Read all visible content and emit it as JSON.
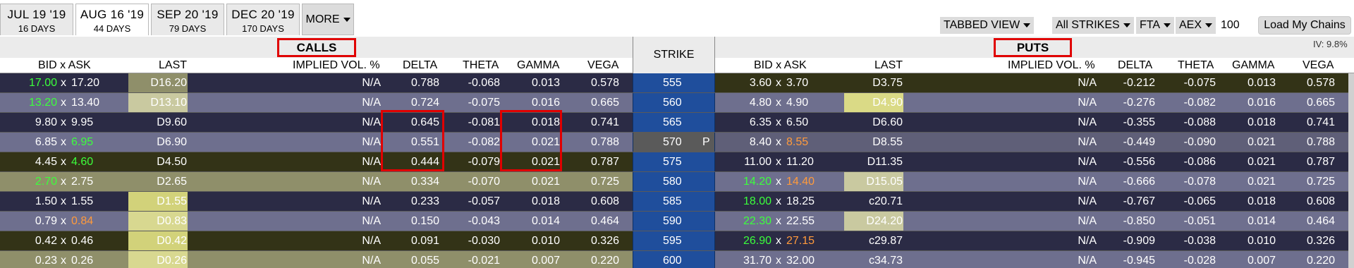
{
  "expiry_tabs": [
    {
      "date": "JUL 19 '19",
      "days": "16 DAYS"
    },
    {
      "date": "AUG 16 '19",
      "days": "44 DAYS"
    },
    {
      "date": "SEP 20 '19",
      "days": "79 DAYS"
    },
    {
      "date": "DEC 20 '19",
      "days": "170 DAYS"
    }
  ],
  "more_label": "MORE",
  "controls": {
    "view": "TABBED VIEW",
    "strikes": "All STRIKES",
    "exchange": "FTA",
    "index": "AEX",
    "quantity": "100",
    "load_button": "Load My Chains",
    "iv": "IV: 9.8%"
  },
  "calls_title": "CALLS",
  "puts_title": "PUTS",
  "strike_header": "STRIKE",
  "columns": {
    "bid_ask": "BID x ASK",
    "last": "LAST",
    "ivol": "IMPLIED VOL. %",
    "delta": "DELTA",
    "theta": "THETA",
    "gamma": "GAMMA",
    "vega": "VEGA"
  },
  "rows": [
    {
      "strike": "555",
      "p": "",
      "call": {
        "bid": "17.00",
        "ask": "17.20",
        "last": "D16.20",
        "iv": "N/A",
        "delta": "0.788",
        "theta": "-0.068",
        "gamma": "0.013",
        "vega": "0.578"
      },
      "put": {
        "bid": "3.60",
        "ask": "3.70",
        "last": "D3.75",
        "iv": "N/A",
        "delta": "-0.212",
        "theta": "-0.075",
        "gamma": "0.013",
        "vega": "0.578"
      }
    },
    {
      "strike": "560",
      "p": "",
      "call": {
        "bid": "13.20",
        "ask": "13.40",
        "last": "D13.10",
        "iv": "N/A",
        "delta": "0.724",
        "theta": "-0.075",
        "gamma": "0.016",
        "vega": "0.665"
      },
      "put": {
        "bid": "4.80",
        "ask": "4.90",
        "last": "D4.90",
        "iv": "N/A",
        "delta": "-0.276",
        "theta": "-0.082",
        "gamma": "0.016",
        "vega": "0.665"
      }
    },
    {
      "strike": "565",
      "p": "",
      "call": {
        "bid": "9.80",
        "ask": "9.95",
        "last": "D9.60",
        "iv": "N/A",
        "delta": "0.645",
        "theta": "-0.081",
        "gamma": "0.018",
        "vega": "0.741"
      },
      "put": {
        "bid": "6.35",
        "ask": "6.50",
        "last": "D6.60",
        "iv": "N/A",
        "delta": "-0.355",
        "theta": "-0.088",
        "gamma": "0.018",
        "vega": "0.741"
      }
    },
    {
      "strike": "570",
      "p": "P",
      "call": {
        "bid": "6.85",
        "ask": "6.95",
        "last": "D6.90",
        "iv": "N/A",
        "delta": "0.551",
        "theta": "-0.082",
        "gamma": "0.021",
        "vega": "0.788"
      },
      "put": {
        "bid": "8.40",
        "ask": "8.55",
        "last": "D8.55",
        "iv": "N/A",
        "delta": "-0.449",
        "theta": "-0.090",
        "gamma": "0.021",
        "vega": "0.788"
      }
    },
    {
      "strike": "575",
      "p": "",
      "call": {
        "bid": "4.45",
        "ask": "4.60",
        "last": "D4.50",
        "iv": "N/A",
        "delta": "0.444",
        "theta": "-0.079",
        "gamma": "0.021",
        "vega": "0.787"
      },
      "put": {
        "bid": "11.00",
        "ask": "11.20",
        "last": "D11.35",
        "iv": "N/A",
        "delta": "-0.556",
        "theta": "-0.086",
        "gamma": "0.021",
        "vega": "0.787"
      }
    },
    {
      "strike": "580",
      "p": "",
      "call": {
        "bid": "2.70",
        "ask": "2.75",
        "last": "D2.65",
        "iv": "N/A",
        "delta": "0.334",
        "theta": "-0.070",
        "gamma": "0.021",
        "vega": "0.725"
      },
      "put": {
        "bid": "14.20",
        "ask": "14.40",
        "last": "D15.05",
        "iv": "N/A",
        "delta": "-0.666",
        "theta": "-0.078",
        "gamma": "0.021",
        "vega": "0.725"
      }
    },
    {
      "strike": "585",
      "p": "",
      "call": {
        "bid": "1.50",
        "ask": "1.55",
        "last": "D1.55",
        "iv": "N/A",
        "delta": "0.233",
        "theta": "-0.057",
        "gamma": "0.018",
        "vega": "0.608"
      },
      "put": {
        "bid": "18.00",
        "ask": "18.25",
        "last": "c20.71",
        "iv": "N/A",
        "delta": "-0.767",
        "theta": "-0.065",
        "gamma": "0.018",
        "vega": "0.608"
      }
    },
    {
      "strike": "590",
      "p": "",
      "call": {
        "bid": "0.79",
        "ask": "0.84",
        "last": "D0.83",
        "iv": "N/A",
        "delta": "0.150",
        "theta": "-0.043",
        "gamma": "0.014",
        "vega": "0.464"
      },
      "put": {
        "bid": "22.30",
        "ask": "22.55",
        "last": "D24.20",
        "iv": "N/A",
        "delta": "-0.850",
        "theta": "-0.051",
        "gamma": "0.014",
        "vega": "0.464"
      }
    },
    {
      "strike": "595",
      "p": "",
      "call": {
        "bid": "0.42",
        "ask": "0.46",
        "last": "D0.42",
        "iv": "N/A",
        "delta": "0.091",
        "theta": "-0.030",
        "gamma": "0.010",
        "vega": "0.326"
      },
      "put": {
        "bid": "26.90",
        "ask": "27.15",
        "last": "c29.87",
        "iv": "N/A",
        "delta": "-0.909",
        "theta": "-0.038",
        "gamma": "0.010",
        "vega": "0.326"
      }
    },
    {
      "strike": "600",
      "p": "",
      "call": {
        "bid": "0.23",
        "ask": "0.26",
        "last": "D0.26",
        "iv": "N/A",
        "delta": "0.055",
        "theta": "-0.021",
        "gamma": "0.007",
        "vega": "0.220"
      },
      "put": {
        "bid": "31.70",
        "ask": "32.00",
        "last": "c34.73",
        "iv": "N/A",
        "delta": "-0.945",
        "theta": "-0.028",
        "gamma": "0.007",
        "vega": "0.220"
      }
    }
  ]
}
